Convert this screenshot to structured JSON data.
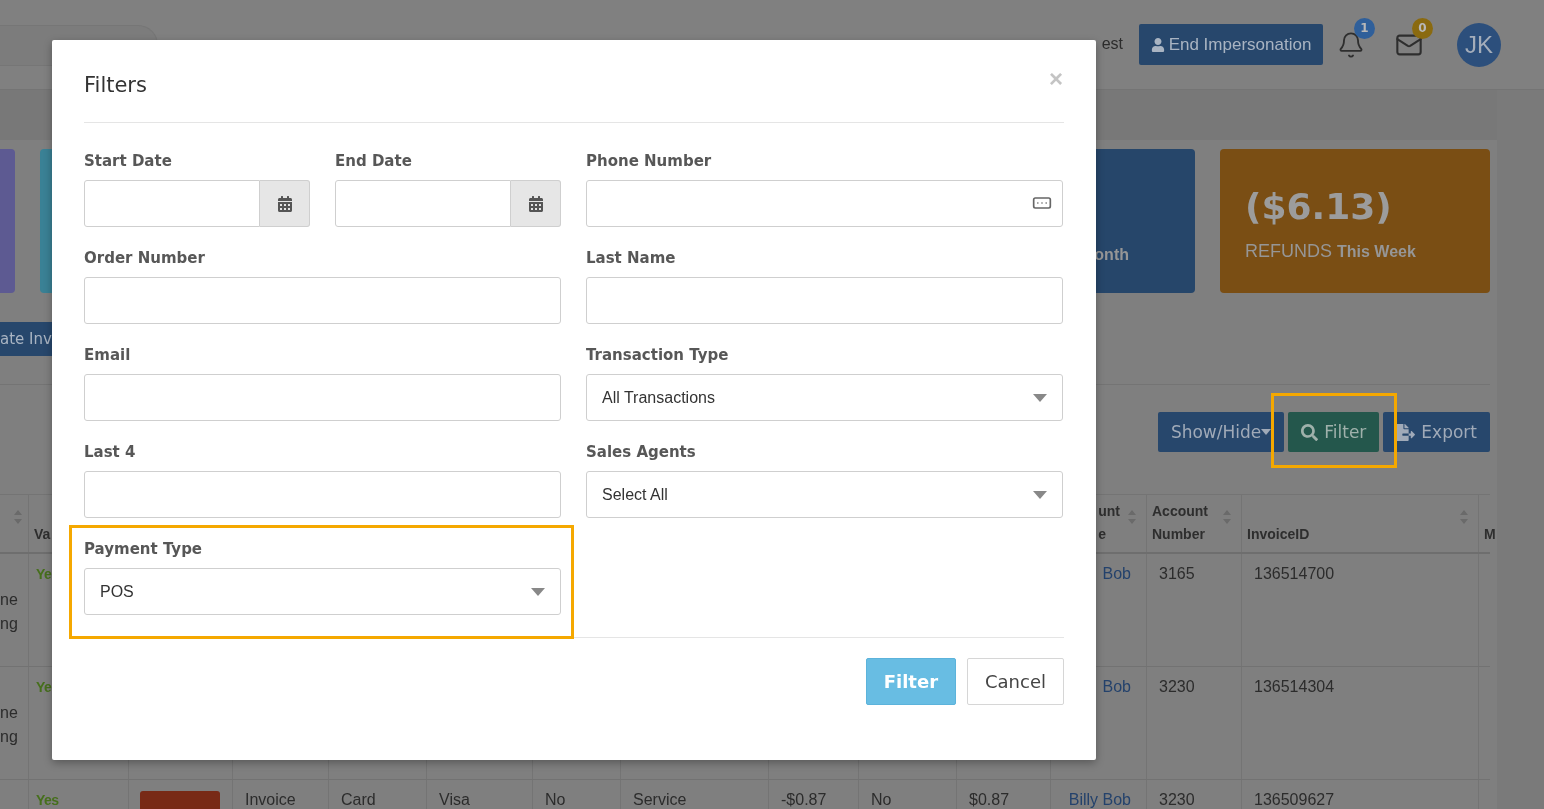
{
  "header": {
    "greeting": "est",
    "impersonation_button": "End Impersonation",
    "notifications": {
      "count": "1"
    },
    "messages": {
      "count": "0"
    },
    "avatar": "JK"
  },
  "stat_cards": [
    {
      "color": "#5d5a92"
    },
    {
      "color": "#3a8195"
    },
    {
      "color": "#26466a",
      "label": "**onth**"
    },
    {
      "color": "#7a4e14",
      "value": "($6.13)",
      "label": "REFUNDS **This Week**"
    }
  ],
  "create_button": "ate Inv",
  "toolbar": [
    {
      "kind": "dropdown",
      "label": "Show/Hide"
    },
    {
      "kind": "filter",
      "label": "Filter",
      "highlighted": true
    },
    {
      "kind": "export",
      "label": "Export"
    }
  ],
  "table": {
    "columns": [
      {
        "sortable": true
      },
      {
        "label": "Va",
        "sortable": false
      },
      null,
      null,
      null,
      null,
      null,
      null,
      null,
      null,
      null,
      {
        "label": "unt\ne",
        "sortable": true
      },
      {
        "label": "Account\nNumber",
        "sortable": true
      },
      {
        "label": "InvoiceID",
        "sortable": true
      },
      {
        "label": "M",
        "sortable": false
      }
    ],
    "rows": [
      {
        "cells": [
          {
            "kind": "text",
            "text": "ne\nng"
          },
          {
            "kind": "status",
            "text": "Ye"
          },
          null,
          null,
          null,
          null,
          null,
          null,
          null,
          null,
          null,
          {
            "kind": "link",
            "text": "Bob"
          },
          {
            "kind": "text",
            "text": "3165"
          },
          {
            "kind": "text",
            "text": "136514700"
          },
          null
        ]
      },
      {
        "cells": [
          {
            "kind": "text",
            "text": "ne\nng"
          },
          {
            "kind": "status",
            "text": "Ye"
          },
          null,
          null,
          null,
          null,
          null,
          null,
          null,
          null,
          null,
          {
            "kind": "link",
            "text": "Bob"
          },
          {
            "kind": "text",
            "text": "3230"
          },
          {
            "kind": "text",
            "text": "136514304"
          },
          null
        ]
      },
      {
        "cells": [
          null,
          {
            "kind": "status",
            "text": "Yes"
          },
          {
            "kind": "action"
          },
          {
            "kind": "text",
            "text": "Invoice"
          },
          {
            "kind": "text",
            "text": "Card"
          },
          {
            "kind": "text",
            "text": "Visa"
          },
          {
            "kind": "text",
            "text": "No"
          },
          {
            "kind": "text",
            "text": "Service"
          },
          {
            "kind": "text",
            "text": "-$0.87"
          },
          {
            "kind": "text",
            "text": "No"
          },
          {
            "kind": "text",
            "text": "$0.87"
          },
          {
            "kind": "link",
            "text": "Billy Bob"
          },
          {
            "kind": "text",
            "text": "3230"
          },
          {
            "kind": "text",
            "text": "136509627"
          },
          null
        ]
      }
    ]
  },
  "modal": {
    "title": "Filters",
    "close": "×",
    "fields": [
      {
        "label": "Start Date",
        "kind": "date"
      },
      {
        "label": "End Date",
        "kind": "date"
      },
      {
        "label": "Phone Number",
        "kind": "phone"
      },
      {
        "label": "Order Number",
        "kind": "text"
      },
      {
        "label": "Last Name",
        "kind": "text"
      },
      {
        "label": "Email",
        "kind": "text"
      },
      {
        "label": "Transaction Type",
        "kind": "select",
        "value": "All Transactions"
      },
      {
        "label": "Last 4",
        "kind": "text"
      },
      {
        "label": "Sales Agents",
        "kind": "select",
        "value": "Select All"
      },
      {
        "label": "Payment Type",
        "kind": "select",
        "value": "POS",
        "highlighted": true
      }
    ],
    "buttons": [
      {
        "kind": "primary",
        "label": "Filter"
      },
      {
        "kind": "default",
        "label": "Cancel"
      }
    ]
  }
}
